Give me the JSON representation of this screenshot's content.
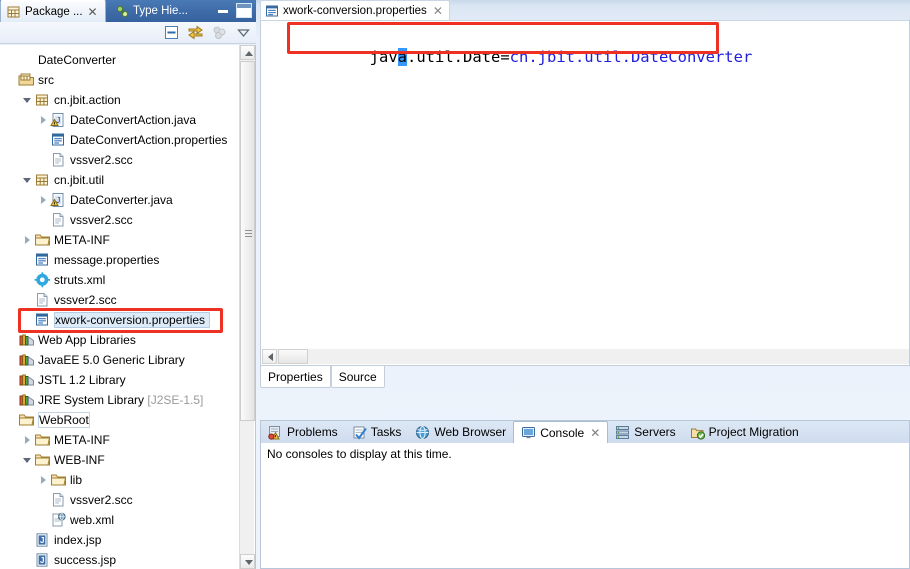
{
  "views": {
    "package_explorer_tab": "Package ...",
    "type_hierarchy_tab": "Type Hie...",
    "close_glyph": "✕",
    "minimize_title": "Minimize",
    "maximize_title": "Maximize"
  },
  "toolbar": {
    "collapse_all": "collapse-all-icon",
    "link_with_editor": "link-with-editor-icon",
    "focus_on_active": "focus-icon",
    "view_menu": "view-menu-icon"
  },
  "tree": [
    {
      "label": "DateConverter",
      "indent": 0,
      "arrow": "none",
      "icon": "none",
      "selected": false
    },
    {
      "label": "src",
      "indent": 0,
      "arrow": "none",
      "icon": "source-folder",
      "selected": false
    },
    {
      "label": "cn.jbit.action",
      "indent": 1,
      "arrow": "open",
      "icon": "package",
      "selected": false
    },
    {
      "label": "DateConvertAction.java",
      "indent": 2,
      "arrow": "closed",
      "icon": "java-warn",
      "selected": false
    },
    {
      "label": "DateConvertAction.properties",
      "indent": 2,
      "arrow": "none",
      "icon": "properties",
      "selected": false
    },
    {
      "label": "vssver2.scc",
      "indent": 2,
      "arrow": "none",
      "icon": "file",
      "selected": false
    },
    {
      "label": "cn.jbit.util",
      "indent": 1,
      "arrow": "open",
      "icon": "package",
      "selected": false
    },
    {
      "label": "DateConverter.java",
      "indent": 2,
      "arrow": "closed",
      "icon": "java-warn",
      "selected": false
    },
    {
      "label": "vssver2.scc",
      "indent": 2,
      "arrow": "none",
      "icon": "file",
      "selected": false
    },
    {
      "label": "META-INF",
      "indent": 1,
      "arrow": "closed",
      "icon": "folder",
      "selected": false
    },
    {
      "label": "message.properties",
      "indent": 1,
      "arrow": "none",
      "icon": "properties",
      "selected": false
    },
    {
      "label": "struts.xml",
      "indent": 1,
      "arrow": "none",
      "icon": "xml-gear",
      "selected": false
    },
    {
      "label": "vssver2.scc",
      "indent": 1,
      "arrow": "none",
      "icon": "file",
      "selected": false
    },
    {
      "label": "xwork-conversion.properties",
      "indent": 1,
      "arrow": "none",
      "icon": "properties",
      "selected": true
    },
    {
      "label": "Web App Libraries",
      "indent": 0,
      "arrow": "none",
      "icon": "library",
      "selected": false
    },
    {
      "label": "JavaEE 5.0 Generic Library",
      "indent": 0,
      "arrow": "none",
      "icon": "library",
      "selected": false
    },
    {
      "label": "JSTL 1.2 Library",
      "indent": 0,
      "arrow": "none",
      "icon": "library",
      "selected": false
    },
    {
      "label": "JRE System Library",
      "indent": 0,
      "arrow": "none",
      "icon": "library",
      "selected": false,
      "suffix": " [J2SE-1.5]"
    },
    {
      "label": "WebRoot",
      "indent": 0,
      "arrow": "none",
      "icon": "folder",
      "selected": false,
      "focus": true
    },
    {
      "label": "META-INF",
      "indent": 1,
      "arrow": "closed",
      "icon": "folder",
      "selected": false
    },
    {
      "label": "WEB-INF",
      "indent": 1,
      "arrow": "open",
      "icon": "folder",
      "selected": false
    },
    {
      "label": "lib",
      "indent": 2,
      "arrow": "closed",
      "icon": "folder",
      "selected": false
    },
    {
      "label": "vssver2.scc",
      "indent": 2,
      "arrow": "none",
      "icon": "file",
      "selected": false
    },
    {
      "label": "web.xml",
      "indent": 2,
      "arrow": "none",
      "icon": "web-xml",
      "selected": false
    },
    {
      "label": "index.jsp",
      "indent": 1,
      "arrow": "none",
      "icon": "jsp",
      "selected": false
    },
    {
      "label": "success.jsp",
      "indent": 1,
      "arrow": "none",
      "icon": "jsp",
      "selected": false
    }
  ],
  "editor": {
    "tab_label": "xwork-conversion.properties",
    "tab_icon": "properties-icon",
    "close_glyph": "✕",
    "code_key_part1": "jav",
    "code_selected_char": "a",
    "code_key_part2": ".util.Date=",
    "code_value": "cn.jbit.util.DateConverter",
    "bottom_tabs": [
      {
        "label": "Properties",
        "active": true
      },
      {
        "label": "Source",
        "active": false
      }
    ]
  },
  "console": {
    "tabs": [
      {
        "label": "Problems",
        "icon": "problems-icon",
        "active": false,
        "closable": false
      },
      {
        "label": "Tasks",
        "icon": "tasks-icon",
        "active": false,
        "closable": false
      },
      {
        "label": "Web Browser",
        "icon": "browser-icon",
        "active": false,
        "closable": false
      },
      {
        "label": "Console",
        "icon": "console-icon",
        "active": true,
        "closable": true
      },
      {
        "label": "Servers",
        "icon": "servers-icon",
        "active": false,
        "closable": false
      },
      {
        "label": "Project Migration",
        "icon": "migration-icon",
        "active": false,
        "closable": false
      }
    ],
    "empty_message": "No consoles to display at this time."
  },
  "annotations": {
    "editor_highlight": "red-rectangle-around-code-line",
    "tree_highlight": "red-rectangle-around-xwork-conversion-properties"
  },
  "colors": {
    "accent_blue": "#3f6ca8",
    "annotation_red": "#ef3124",
    "code_value_blue": "#2020dd",
    "selection_blue": "#3399ff"
  }
}
